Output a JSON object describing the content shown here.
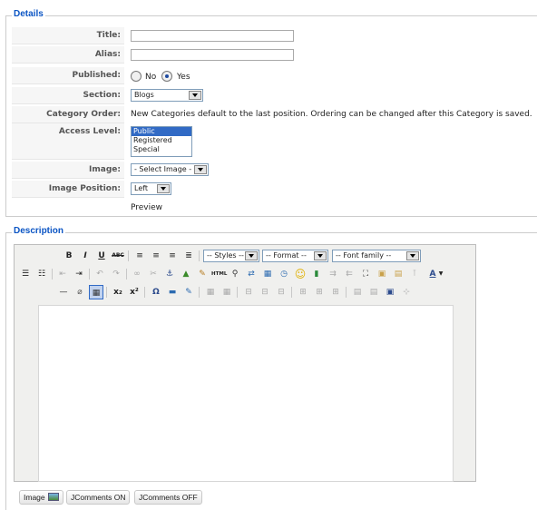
{
  "details": {
    "legend": "Details",
    "title_label": "Title:",
    "alias_label": "Alias:",
    "published_label": "Published:",
    "published_options": [
      "No",
      "Yes"
    ],
    "published_value": "Yes",
    "section_label": "Section:",
    "section_value": "Blogs",
    "category_order_label": "Category Order:",
    "category_order_text": "New Categories default to the last position. Ordering can be changed after this Category is saved.",
    "access_label": "Access Level:",
    "access_options": [
      "Public",
      "Registered",
      "Special"
    ],
    "access_selected": "Public",
    "image_label": "Image:",
    "image_value": "- Select Image -",
    "image_position_label": "Image Position:",
    "image_position_value": "Left",
    "preview_label": "Preview"
  },
  "description": {
    "legend": "Description",
    "toolbar": {
      "styles": "-- Styles --",
      "format": "-- Format --",
      "font_family": "-- Font family --",
      "bold": "B",
      "italic": "I",
      "underline": "U",
      "strike": "ABC",
      "html": "HTML",
      "omega": "Ω",
      "subscript": "x₂",
      "superscript": "x²"
    },
    "buttons": {
      "image": "Image",
      "jcomments_on": "JComments ON",
      "jcomments_off": "JComments OFF"
    }
  }
}
